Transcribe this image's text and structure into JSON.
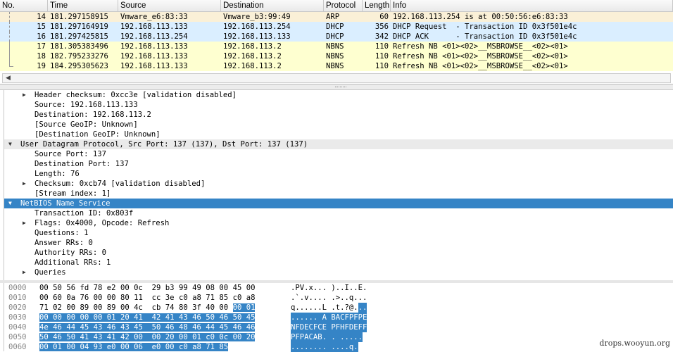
{
  "columns": [
    "No.",
    "Time",
    "Source",
    "Destination",
    "Protocol",
    "Length",
    "Info"
  ],
  "colors": {
    "arp": "#faf0d7",
    "dhcp": "#daeeff",
    "nbns": "#feffd0",
    "selected": "#3584c6"
  },
  "packets": [
    {
      "no": "14",
      "time": "181.297158915",
      "src": "Vmware_e6:83:33",
      "dst": "Vmware_b3:99:49",
      "proto": "ARP",
      "len": "60",
      "info": "192.168.113.254 is at 00:50:56:e6:83:33",
      "kind": "arp"
    },
    {
      "no": "15",
      "time": "181.297164919",
      "src": "192.168.113.133",
      "dst": "192.168.113.254",
      "proto": "DHCP",
      "len": "356",
      "info": "DHCP Request  - Transaction ID 0x3f501e4c",
      "kind": "dhcp"
    },
    {
      "no": "16",
      "time": "181.297425815",
      "src": "192.168.113.254",
      "dst": "192.168.113.133",
      "proto": "DHCP",
      "len": "342",
      "info": "DHCP ACK      - Transaction ID 0x3f501e4c",
      "kind": "dhcp"
    },
    {
      "no": "17",
      "time": "181.305383496",
      "src": "192.168.113.133",
      "dst": "192.168.113.2",
      "proto": "NBNS",
      "len": "110",
      "info": "Refresh NB <01><02>__MSBROWSE__<02><01>",
      "kind": "nbns"
    },
    {
      "no": "18",
      "time": "182.795233276",
      "src": "192.168.113.133",
      "dst": "192.168.113.2",
      "proto": "NBNS",
      "len": "110",
      "info": "Refresh NB <01><02>__MSBROWSE__<02><01>",
      "kind": "nbns"
    },
    {
      "no": "19",
      "time": "184.295305623",
      "src": "192.168.113.133",
      "dst": "192.168.113.2",
      "proto": "NBNS",
      "len": "110",
      "info": "Refresh NB <01><02>__MSBROWSE__<02><01>",
      "kind": "nbns"
    }
  ],
  "details": [
    {
      "text": "Header checksum: 0xcc3e [validation disabled]",
      "level": 2,
      "exp": "collapsed"
    },
    {
      "text": "Source: 192.168.113.133",
      "level": 2
    },
    {
      "text": "Destination: 192.168.113.2",
      "level": 2
    },
    {
      "text": "[Source GeoIP: Unknown]",
      "level": 2
    },
    {
      "text": "[Destination GeoIP: Unknown]",
      "level": 2
    },
    {
      "text": "User Datagram Protocol, Src Port: 137 (137), Dst Port: 137 (137)",
      "level": 1,
      "exp": "expanded",
      "style": "grey"
    },
    {
      "text": "Source Port: 137",
      "level": 2
    },
    {
      "text": "Destination Port: 137",
      "level": 2
    },
    {
      "text": "Length: 76",
      "level": 2
    },
    {
      "text": "Checksum: 0xcb74 [validation disabled]",
      "level": 2,
      "exp": "collapsed"
    },
    {
      "text": "[Stream index: 1]",
      "level": 2
    },
    {
      "text": "NetBIOS Name Service",
      "level": 1,
      "exp": "expanded",
      "style": "sel"
    },
    {
      "text": "Transaction ID: 0x803f",
      "level": 2
    },
    {
      "text": "Flags: 0x4000, Opcode: Refresh",
      "level": 2,
      "exp": "collapsed"
    },
    {
      "text": "Questions: 1",
      "level": 2
    },
    {
      "text": "Answer RRs: 0",
      "level": 2
    },
    {
      "text": "Authority RRs: 0",
      "level": 2
    },
    {
      "text": "Additional RRs: 1",
      "level": 2
    },
    {
      "text": "Queries",
      "level": 2,
      "exp": "collapsed"
    }
  ],
  "hex": {
    "selection_start": 46,
    "rows": [
      {
        "off": "0000",
        "bytes": "00 50 56 fd 78 e2 00 0c 29 b3 99 49 08 00 45 00",
        "ascii": ".PV.x... )..I..E."
      },
      {
        "off": "0010",
        "bytes": "00 60 0a 76 00 00 80 11 cc 3e c0 a8 71 85 c0 a8",
        "ascii": ".`.v.... .>..q..."
      },
      {
        "off": "0020",
        "bytes": "71 02 00 89 00 89 00 4c cb 74 80 3f 40 00 00 01",
        "ascii": "q......L .t.?@..."
      },
      {
        "off": "0030",
        "bytes": "00 00 00 00 00 01 20 41 42 41 43 46 50 46 50 45",
        "ascii": "...... A BACFPFPE"
      },
      {
        "off": "0040",
        "bytes": "4e 46 44 45 43 46 43 45 50 46 48 46 44 45 46 46",
        "ascii": "NFDECFCE PFHFDEFF"
      },
      {
        "off": "0050",
        "bytes": "50 46 50 41 43 41 42 00 00 20 00 01 c0 0c 00 20",
        "ascii": "PFPACAB. . ....."
      },
      {
        "off": "0060",
        "bytes": "00 01 00 04 93 e0 00 06 e0 00 c0 a8 71 85",
        "ascii": "........ ....q."
      }
    ]
  },
  "watermark": "drops.wooyun.org"
}
